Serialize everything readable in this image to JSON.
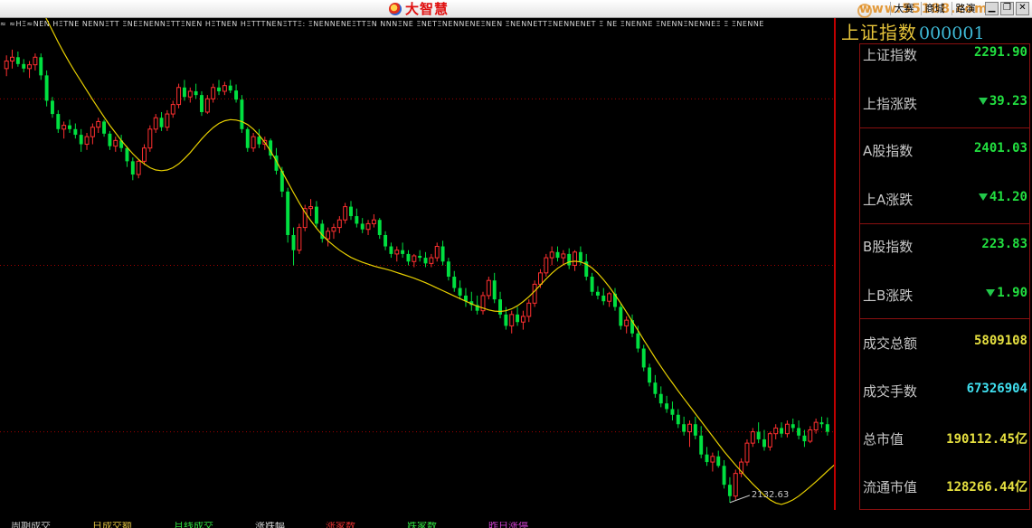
{
  "window": {
    "app_name": "大智慧",
    "buttons": [
      "大赛",
      "商城",
      "路演"
    ],
    "watermark": "www.55188.com"
  },
  "ticker_strip": "≈ ≈ΗΞ≈ΝΕΝ ΗΞΤΝΕ ΝΕΝΝΞΤΤ ΞΝΕΞΝΕΝΝΞΤΤΞΝΕΝ ΗΞΤΝΕΝ ΗΞΤΤΤΝΕΝΞΤΤΞ: ΞΝΕΝΝΕΝΕΞΤΤΞΝ ΝΝΝΞΝΕ ΞΝΕΤΞΝΕΝΝΕΝΕΞΝΕΝ ΞΝΕΝΝΕΤΤΞΝΕΝΝΕΝΕΤ Ξ ΝΕ ΞΝΕΝΝΕ ΞΝΕΝΝΞΝΕΝΝΕΞ Ξ ΞΝΕΝΝΕ",
  "chart_data": {
    "type": "candlestick",
    "title": "",
    "price_range": [
      2132.63,
      3380
    ],
    "low_annotation": "2132.63",
    "up_color": "#ff3030",
    "down_color": "#00e040",
    "ma_color": "#e8d000",
    "gridline_color": "#a00000",
    "ohlc": [
      [
        3280,
        3315,
        3260,
        3300
      ],
      [
        3300,
        3330,
        3280,
        3310
      ],
      [
        3310,
        3325,
        3285,
        3292
      ],
      [
        3292,
        3305,
        3270,
        3280
      ],
      [
        3280,
        3300,
        3255,
        3290
      ],
      [
        3290,
        3320,
        3275,
        3310
      ],
      [
        3310,
        3320,
        3250,
        3262
      ],
      [
        3262,
        3275,
        3180,
        3195
      ],
      [
        3195,
        3205,
        3150,
        3160
      ],
      [
        3160,
        3170,
        3110,
        3120
      ],
      [
        3120,
        3140,
        3095,
        3130
      ],
      [
        3130,
        3145,
        3110,
        3120
      ],
      [
        3120,
        3135,
        3095,
        3105
      ],
      [
        3105,
        3120,
        3060,
        3080
      ],
      [
        3080,
        3110,
        3065,
        3100
      ],
      [
        3100,
        3135,
        3080,
        3125
      ],
      [
        3125,
        3150,
        3110,
        3140
      ],
      [
        3140,
        3145,
        3100,
        3108
      ],
      [
        3108,
        3115,
        3065,
        3075
      ],
      [
        3075,
        3100,
        3060,
        3090
      ],
      [
        3090,
        3105,
        3060,
        3070
      ],
      [
        3070,
        3075,
        3020,
        3035
      ],
      [
        3035,
        3045,
        2985,
        3000
      ],
      [
        3000,
        3040,
        2990,
        3035
      ],
      [
        3035,
        3080,
        3025,
        3070
      ],
      [
        3070,
        3130,
        3060,
        3120
      ],
      [
        3120,
        3160,
        3110,
        3150
      ],
      [
        3150,
        3165,
        3115,
        3125
      ],
      [
        3125,
        3170,
        3115,
        3160
      ],
      [
        3160,
        3195,
        3150,
        3185
      ],
      [
        3185,
        3240,
        3175,
        3230
      ],
      [
        3230,
        3250,
        3195,
        3205
      ],
      [
        3205,
        3230,
        3190,
        3220
      ],
      [
        3220,
        3240,
        3200,
        3210
      ],
      [
        3210,
        3220,
        3155,
        3165
      ],
      [
        3165,
        3210,
        3160,
        3200
      ],
      [
        3200,
        3240,
        3190,
        3230
      ],
      [
        3230,
        3250,
        3210,
        3220
      ],
      [
        3220,
        3245,
        3210,
        3235
      ],
      [
        3235,
        3250,
        3215,
        3222
      ],
      [
        3222,
        3238,
        3190,
        3198
      ],
      [
        3198,
        3210,
        3110,
        3120
      ],
      [
        3120,
        3125,
        3060,
        3070
      ],
      [
        3070,
        3110,
        3060,
        3100
      ],
      [
        3100,
        3120,
        3070,
        3080
      ],
      [
        3080,
        3100,
        3065,
        3090
      ],
      [
        3090,
        3095,
        3040,
        3050
      ],
      [
        3050,
        3070,
        3000,
        3010
      ],
      [
        3010,
        3020,
        2940,
        2955
      ],
      [
        2955,
        2965,
        2820,
        2840
      ],
      [
        2840,
        2860,
        2760,
        2800
      ],
      [
        2800,
        2870,
        2790,
        2860
      ],
      [
        2860,
        2920,
        2850,
        2910
      ],
      [
        2910,
        2935,
        2890,
        2915
      ],
      [
        2915,
        2930,
        2860,
        2870
      ],
      [
        2870,
        2880,
        2820,
        2830
      ],
      [
        2830,
        2860,
        2810,
        2850
      ],
      [
        2850,
        2870,
        2830,
        2860
      ],
      [
        2860,
        2890,
        2845,
        2880
      ],
      [
        2880,
        2925,
        2870,
        2915
      ],
      [
        2915,
        2930,
        2880,
        2890
      ],
      [
        2890,
        2910,
        2860,
        2870
      ],
      [
        2870,
        2885,
        2845,
        2855
      ],
      [
        2855,
        2880,
        2840,
        2870
      ],
      [
        2870,
        2895,
        2860,
        2880
      ],
      [
        2880,
        2885,
        2830,
        2840
      ],
      [
        2840,
        2850,
        2800,
        2810
      ],
      [
        2810,
        2820,
        2780,
        2790
      ],
      [
        2790,
        2810,
        2770,
        2800
      ],
      [
        2800,
        2820,
        2780,
        2790
      ],
      [
        2790,
        2800,
        2760,
        2770
      ],
      [
        2770,
        2790,
        2755,
        2785
      ],
      [
        2785,
        2800,
        2770,
        2780
      ],
      [
        2780,
        2795,
        2755,
        2765
      ],
      [
        2765,
        2790,
        2755,
        2780
      ],
      [
        2780,
        2820,
        2770,
        2810
      ],
      [
        2810,
        2825,
        2760,
        2770
      ],
      [
        2770,
        2780,
        2720,
        2730
      ],
      [
        2730,
        2745,
        2690,
        2700
      ],
      [
        2700,
        2720,
        2670,
        2680
      ],
      [
        2680,
        2700,
        2650,
        2665
      ],
      [
        2665,
        2690,
        2640,
        2655
      ],
      [
        2655,
        2680,
        2630,
        2640
      ],
      [
        2640,
        2690,
        2630,
        2680
      ],
      [
        2680,
        2730,
        2670,
        2720
      ],
      [
        2720,
        2740,
        2660,
        2670
      ],
      [
        2670,
        2690,
        2620,
        2630
      ],
      [
        2630,
        2650,
        2590,
        2600
      ],
      [
        2600,
        2640,
        2580,
        2630
      ],
      [
        2630,
        2650,
        2600,
        2610
      ],
      [
        2610,
        2640,
        2590,
        2625
      ],
      [
        2625,
        2670,
        2610,
        2660
      ],
      [
        2660,
        2720,
        2650,
        2710
      ],
      [
        2710,
        2750,
        2700,
        2740
      ],
      [
        2740,
        2790,
        2730,
        2780
      ],
      [
        2780,
        2810,
        2760,
        2795
      ],
      [
        2795,
        2810,
        2770,
        2780
      ],
      [
        2780,
        2800,
        2760,
        2790
      ],
      [
        2790,
        2805,
        2750,
        2760
      ],
      [
        2760,
        2800,
        2745,
        2795
      ],
      [
        2795,
        2810,
        2760,
        2770
      ],
      [
        2770,
        2790,
        2720,
        2730
      ],
      [
        2730,
        2740,
        2680,
        2690
      ],
      [
        2690,
        2705,
        2670,
        2680
      ],
      [
        2680,
        2700,
        2655,
        2665
      ],
      [
        2665,
        2690,
        2650,
        2685
      ],
      [
        2685,
        2700,
        2640,
        2650
      ],
      [
        2650,
        2660,
        2590,
        2600
      ],
      [
        2600,
        2625,
        2580,
        2615
      ],
      [
        2615,
        2630,
        2570,
        2580
      ],
      [
        2580,
        2600,
        2530,
        2540
      ],
      [
        2540,
        2550,
        2480,
        2490
      ],
      [
        2490,
        2500,
        2440,
        2450
      ],
      [
        2450,
        2470,
        2410,
        2420
      ],
      [
        2420,
        2440,
        2385,
        2395
      ],
      [
        2395,
        2415,
        2370,
        2380
      ],
      [
        2380,
        2400,
        2350,
        2365
      ],
      [
        2365,
        2380,
        2330,
        2340
      ],
      [
        2340,
        2360,
        2310,
        2320
      ],
      [
        2320,
        2350,
        2280,
        2340
      ],
      [
        2340,
        2360,
        2300,
        2310
      ],
      [
        2310,
        2335,
        2250,
        2260
      ],
      [
        2260,
        2280,
        2230,
        2240
      ],
      [
        2240,
        2265,
        2215,
        2255
      ],
      [
        2255,
        2270,
        2225,
        2230
      ],
      [
        2230,
        2245,
        2170,
        2180
      ],
      [
        2180,
        2200,
        2133,
        2150
      ],
      [
        2150,
        2220,
        2140,
        2210
      ],
      [
        2210,
        2250,
        2200,
        2240
      ],
      [
        2240,
        2300,
        2230,
        2290
      ],
      [
        2290,
        2330,
        2280,
        2320
      ],
      [
        2320,
        2345,
        2290,
        2300
      ],
      [
        2300,
        2325,
        2270,
        2280
      ],
      [
        2280,
        2320,
        2270,
        2315
      ],
      [
        2315,
        2340,
        2300,
        2330
      ],
      [
        2330,
        2345,
        2305,
        2315
      ],
      [
        2315,
        2350,
        2305,
        2340
      ],
      [
        2340,
        2355,
        2320,
        2330
      ],
      [
        2330,
        2350,
        2300,
        2310
      ],
      [
        2310,
        2325,
        2280,
        2295
      ],
      [
        2295,
        2335,
        2290,
        2325
      ],
      [
        2325,
        2355,
        2315,
        2345
      ],
      [
        2345,
        2360,
        2330,
        2340
      ],
      [
        2340,
        2358,
        2310,
        2320
      ]
    ],
    "ma_values": [
      3650,
      3610,
      3575,
      3540,
      3505,
      3472,
      3440,
      3410,
      3380,
      3350,
      3322,
      3295,
      3270,
      3246,
      3222,
      3198,
      3175,
      3152,
      3130,
      3110,
      3090,
      3072,
      3055,
      3040,
      3028,
      3018,
      3012,
      3010,
      3012,
      3018,
      3028,
      3042,
      3058,
      3076,
      3094,
      3110,
      3124,
      3135,
      3142,
      3145,
      3144,
      3140,
      3132,
      3120,
      3104,
      3085,
      3062,
      3036,
      3008,
      2980,
      2952,
      2925,
      2900,
      2878,
      2858,
      2840,
      2825,
      2812,
      2800,
      2790,
      2781,
      2774,
      2768,
      2763,
      2758,
      2754,
      2750,
      2746,
      2741,
      2736,
      2731,
      2726,
      2720,
      2714,
      2707,
      2700,
      2693,
      2686,
      2679,
      2672,
      2665,
      2658,
      2652,
      2647,
      2642,
      2639,
      2638,
      2640,
      2645,
      2653,
      2664,
      2677,
      2692,
      2708,
      2724,
      2739,
      2752,
      2762,
      2769,
      2771,
      2769,
      2763,
      2753,
      2739,
      2722,
      2703,
      2682,
      2660,
      2636,
      2612,
      2588,
      2563,
      2539,
      2515,
      2492,
      2470,
      2449,
      2428,
      2408,
      2388,
      2368,
      2348,
      2328,
      2308,
      2288,
      2268,
      2250,
      2232,
      2215,
      2198,
      2182,
      2167,
      2152,
      2140,
      2132,
      2128,
      2133,
      2140,
      2150,
      2162,
      2175,
      2188,
      2202,
      2216,
      2230,
      2244,
      2258,
      2272,
      2286,
      2300
    ]
  },
  "sidebar": {
    "index_name": "上证指数",
    "index_code": "000001",
    "rows": [
      {
        "label": "上证指数",
        "value": "2291.90",
        "color": "#22e040",
        "arrow": false
      },
      {
        "label": "上指涨跌",
        "value": "39.23",
        "color": "#22e040",
        "arrow": true
      },
      {
        "label": "A股指数",
        "value": "2401.03",
        "color": "#22e040",
        "arrow": false
      },
      {
        "label": "上A涨跌",
        "value": "41.20",
        "color": "#22e040",
        "arrow": true
      },
      {
        "label": "B股指数",
        "value": "223.83",
        "color": "#22e040",
        "arrow": false
      },
      {
        "label": "上B涨跌",
        "value": "1.90",
        "color": "#22e040",
        "arrow": true
      },
      {
        "label": "成交总额",
        "value": "5809108",
        "color": "#e6e040",
        "arrow": false
      },
      {
        "label": "成交手数",
        "value": "67326904",
        "color": "#40e0f0",
        "arrow": false
      },
      {
        "label": "总市值",
        "value": "190112.45亿",
        "color": "#e6e040",
        "arrow": false
      },
      {
        "label": "流通市值",
        "value": "128266.44亿",
        "color": "#e6e040",
        "arrow": false
      }
    ]
  },
  "bottom_tabs": [
    {
      "label": "周期成交",
      "color": "#c8c8c8"
    },
    {
      "label": "日成交额",
      "color": "#e0c040"
    },
    {
      "label": "月线成交",
      "color": "#30e040"
    },
    {
      "label": "涨跌幅",
      "color": "#d8d8d8"
    },
    {
      "label": "涨家数",
      "color": "#e03030"
    },
    {
      "label": "跌家数",
      "color": "#30e040"
    },
    {
      "label": "昨日涨停",
      "color": "#d040d0"
    }
  ]
}
